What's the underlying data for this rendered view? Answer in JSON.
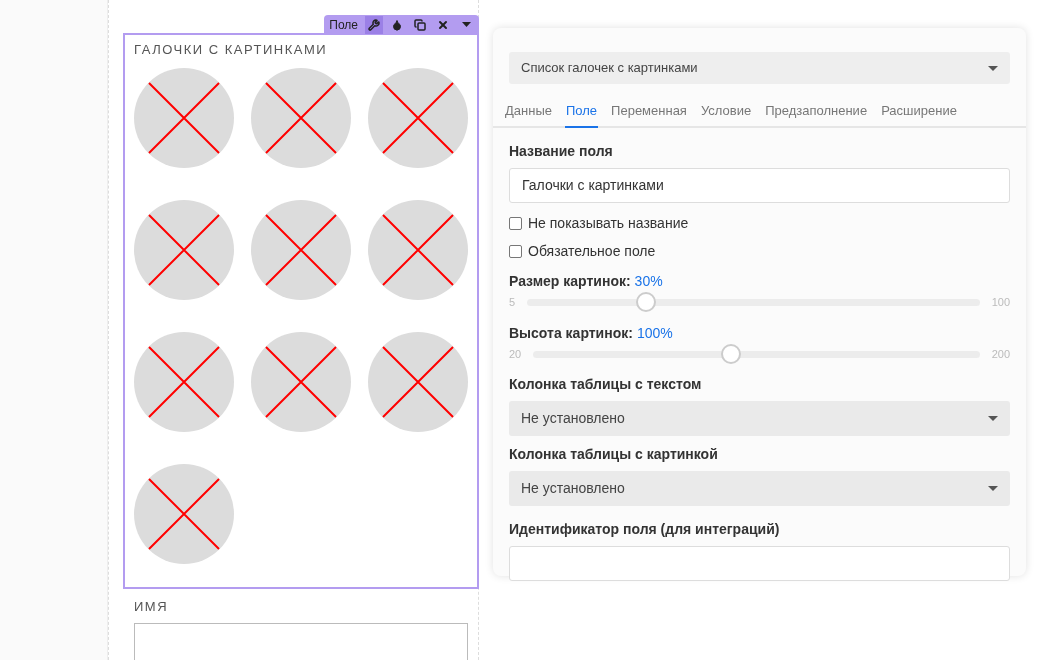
{
  "field_card": {
    "toolbar": {
      "label": "Поле",
      "tools": [
        {
          "kind": "wrench",
          "selected": true
        },
        {
          "kind": "drop",
          "selected": false
        },
        {
          "kind": "copy",
          "selected": false
        },
        {
          "kind": "close",
          "selected": false
        },
        {
          "kind": "caret",
          "selected": false
        }
      ]
    },
    "title": "ГАЛОЧКИ С КАРТИНКАМИ",
    "options": [
      {
        "kind": "image-placeholder"
      },
      {
        "kind": "image-placeholder"
      },
      {
        "kind": "image-placeholder"
      },
      {
        "kind": "image-placeholder"
      },
      {
        "kind": "image-placeholder"
      },
      {
        "kind": "image-placeholder"
      },
      {
        "kind": "image-placeholder"
      },
      {
        "kind": "image-placeholder"
      },
      {
        "kind": "image-placeholder"
      },
      {
        "kind": "image-placeholder"
      }
    ]
  },
  "next_field": {
    "title": "ИМЯ"
  },
  "settings": {
    "type_select": "Список галочек с картинками",
    "tabs": [
      {
        "label": "Данные",
        "selected": false
      },
      {
        "label": "Поле",
        "selected": true
      },
      {
        "label": "Переменная",
        "selected": false
      },
      {
        "label": "Условие",
        "selected": false
      },
      {
        "label": "Предзаполнение",
        "selected": false
      },
      {
        "label": "Расширение",
        "selected": false
      }
    ],
    "name_label": "Название поля",
    "name_value": "Галочки с картинками",
    "checkboxes": [
      {
        "label": "Не показывать название",
        "checked": false
      },
      {
        "label": "Обязательное поле",
        "checked": false
      }
    ],
    "sliders": [
      {
        "label": "Размер картинок:",
        "reading": "30%",
        "min": "5",
        "max": "100",
        "level": 0.263
      },
      {
        "label": "Высота картинок:",
        "reading": "100%",
        "min": "20",
        "max": "200",
        "level": 0.444
      }
    ],
    "selects": [
      {
        "label": "Колонка таблицы с текстом",
        "value": "Не установлено"
      },
      {
        "label": "Колонка таблицы с картинкой",
        "value": "Не установлено"
      }
    ],
    "id_label": "Идентификатор поля (для интеграций)"
  }
}
